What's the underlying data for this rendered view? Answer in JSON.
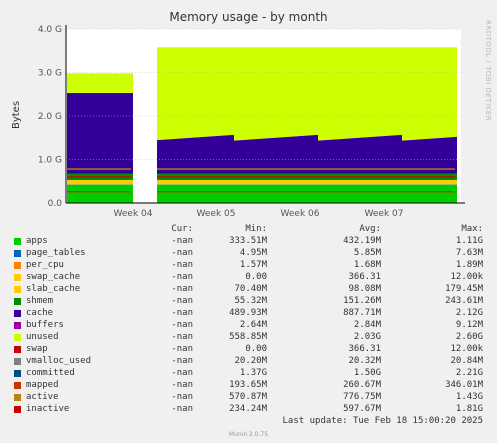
{
  "chart_data": {
    "type": "area",
    "title": "Memory usage - by month",
    "ylabel": "Bytes",
    "ylim_gb": [
      0,
      4.0
    ],
    "yticks": [
      "0.0",
      "1.0 G",
      "2.0 G",
      "3.0 G",
      "4.0 G"
    ],
    "x_labels": [
      "Week 04",
      "Week 05",
      "Week 06",
      "Week 07"
    ],
    "grid": true,
    "stacked_series_gb": [
      {
        "name": "apps",
        "color": "#00cc00",
        "value": 0.42
      },
      {
        "name": "page_tables",
        "color": "#0066b3",
        "value": 0.006
      },
      {
        "name": "per_cpu",
        "color": "#ff8000",
        "value": 0.002
      },
      {
        "name": "swap_cache",
        "color": "#ffcc00",
        "value": 0.0
      },
      {
        "name": "slab_cache",
        "color": "#ffcc00",
        "value": 0.1
      },
      {
        "name": "shmem",
        "color": "#008f00",
        "value": 0.15
      },
      {
        "name": "cache",
        "color": "#330099",
        "value": 0.89
      },
      {
        "name": "buffers",
        "color": "#990099",
        "value": 0.003
      },
      {
        "name": "unused",
        "color": "#ccff00",
        "value": 2.0
      }
    ],
    "line_series_gb": [
      {
        "name": "mapped",
        "color": "#cc3300",
        "value": 0.26
      },
      {
        "name": "active",
        "color": "#b8860b",
        "value": 0.78
      },
      {
        "name": "inactive",
        "color": "#cc0000",
        "value": 0.6
      }
    ]
  },
  "legend": {
    "headers": {
      "cur": "Cur:",
      "min": "Min:",
      "avg": "Avg:",
      "max": "Max:"
    },
    "rows": [
      {
        "name": "apps",
        "color": "#00cc00",
        "cur": "-nan",
        "min": "333.51M",
        "avg": "432.19M",
        "max": "1.11G"
      },
      {
        "name": "page_tables",
        "color": "#0066b3",
        "cur": "-nan",
        "min": "4.95M",
        "avg": "5.85M",
        "max": "7.63M"
      },
      {
        "name": "per_cpu",
        "color": "#ff8000",
        "cur": "-nan",
        "min": "1.57M",
        "avg": "1.68M",
        "max": "1.89M"
      },
      {
        "name": "swap_cache",
        "color": "#ffcc00",
        "cur": "-nan",
        "min": "0.00",
        "avg": "366.31",
        "max": "12.00k"
      },
      {
        "name": "slab_cache",
        "color": "#ffcc00",
        "cur": "-nan",
        "min": "70.40M",
        "avg": "98.08M",
        "max": "179.45M"
      },
      {
        "name": "shmem",
        "color": "#008f00",
        "cur": "-nan",
        "min": "55.32M",
        "avg": "151.26M",
        "max": "243.61M"
      },
      {
        "name": "cache",
        "color": "#330099",
        "cur": "-nan",
        "min": "489.93M",
        "avg": "887.71M",
        "max": "2.12G"
      },
      {
        "name": "buffers",
        "color": "#990099",
        "cur": "-nan",
        "min": "2.64M",
        "avg": "2.84M",
        "max": "9.12M"
      },
      {
        "name": "unused",
        "color": "#ccff00",
        "cur": "-nan",
        "min": "558.85M",
        "avg": "2.03G",
        "max": "2.60G"
      },
      {
        "name": "swap",
        "color": "#cc0000",
        "cur": "-nan",
        "min": "0.00",
        "avg": "366.31",
        "max": "12.00k"
      },
      {
        "name": "vmalloc_used",
        "color": "#808080",
        "cur": "-nan",
        "min": "20.20M",
        "avg": "20.32M",
        "max": "20.84M"
      },
      {
        "name": "committed",
        "color": "#004d80",
        "cur": "-nan",
        "min": "1.37G",
        "avg": "1.50G",
        "max": "2.21G"
      },
      {
        "name": "mapped",
        "color": "#cc3300",
        "cur": "-nan",
        "min": "193.65M",
        "avg": "260.67M",
        "max": "346.01M"
      },
      {
        "name": "active",
        "color": "#b8860b",
        "cur": "-nan",
        "min": "570.87M",
        "avg": "776.75M",
        "max": "1.43G"
      },
      {
        "name": "inactive",
        "color": "#cc0000",
        "cur": "-nan",
        "min": "234.24M",
        "avg": "597.67M",
        "max": "1.81G"
      }
    ]
  },
  "last_update": "Last update:  Tue Feb 18 15:00:20 2025",
  "watermark": "RRDTOOL / TOBI OETIKER",
  "munin_version": "Munin 2.0.75"
}
